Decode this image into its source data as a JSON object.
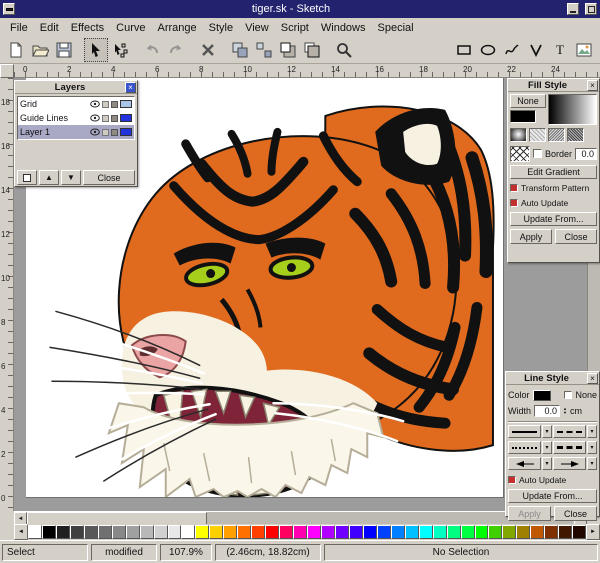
{
  "titlebar": {
    "title": "tiger.sk - Sketch"
  },
  "menubar": {
    "items": [
      "File",
      "Edit",
      "Effects",
      "Curve",
      "Arrange",
      "Style",
      "View",
      "Script",
      "Windows",
      "Special"
    ]
  },
  "toolbar": {
    "tools": [
      "new-document",
      "open-document",
      "save-document",
      "sep",
      "selection-tool",
      "edit-tool",
      "sep",
      "undo",
      "redo",
      "sep",
      "delete",
      "sep",
      "group-objects",
      "ungroup-objects",
      "move-to-front",
      "move-to-back",
      "sep",
      "zoom-tool",
      "spacer",
      "rectangle-tool",
      "ellipse-tool",
      "freehand-tool",
      "bezier-tool",
      "text-tool",
      "image-tool"
    ],
    "active": "selection-tool",
    "disabled": [
      "undo",
      "redo"
    ]
  },
  "ruler_h": {
    "ticks": [
      "0",
      "2",
      "4",
      "6",
      "8",
      "10",
      "12",
      "14",
      "16",
      "18",
      "20",
      "22",
      "24"
    ]
  },
  "ruler_v": {
    "ticks": [
      "18",
      "16",
      "14",
      "12",
      "10",
      "8",
      "6",
      "4",
      "2",
      "0"
    ]
  },
  "layers": {
    "title": "Layers",
    "rows": [
      {
        "name": "Grid",
        "color": "#aac4e8",
        "selected": false
      },
      {
        "name": "Guide Lines",
        "color": "#2233dd",
        "selected": false
      },
      {
        "name": "Layer 1",
        "color": "#2233dd",
        "selected": true
      }
    ],
    "buttons": {
      "up": "▲",
      "down": "▼",
      "close": "Close"
    }
  },
  "fill_style": {
    "title": "Fill Style",
    "none": "None",
    "border": "Border",
    "border_value": "0.0",
    "edit_gradient": "Edit Gradient",
    "transform_pattern": "Transform Pattern",
    "auto_update": "Auto Update",
    "update_from": "Update From...",
    "apply": "Apply",
    "close": "Close"
  },
  "line_style": {
    "title": "Line Style",
    "color": "Color",
    "none": "None",
    "width": "Width",
    "width_value": "0.0",
    "unit": "cm",
    "auto_update": "Auto Update",
    "update_from": "Update From...",
    "apply": "Apply",
    "close": "Close"
  },
  "statusbar": {
    "tool": "Select",
    "modified": "modified",
    "zoom": "107.9%",
    "coords": "(2.46cm, 18.82cm)",
    "selection": "No Selection"
  },
  "palette": {
    "colors": [
      "#ffffff",
      "#000000",
      "#202020",
      "#404040",
      "#585858",
      "#707070",
      "#888888",
      "#a0a0a0",
      "#b8b8b8",
      "#d0d0d0",
      "#e8e8e8",
      "#ffffff",
      "#ffff00",
      "#ffd000",
      "#ffa000",
      "#ff7000",
      "#ff4000",
      "#ff0000",
      "#ff0060",
      "#ff00b0",
      "#ff00ff",
      "#b000ff",
      "#7000ff",
      "#4000ff",
      "#0000ff",
      "#0040ff",
      "#0080ff",
      "#00c0ff",
      "#00ffff",
      "#00ffc0",
      "#00ff80",
      "#00ff40",
      "#00ff00",
      "#40d000",
      "#80a800",
      "#a08000",
      "#c05800",
      "#803000",
      "#401800",
      "#200800"
    ]
  },
  "glyphs": {
    "close": "×",
    "up": "▲",
    "down": "▼",
    "left": "◄",
    "right": "►",
    "dropdown": "▾"
  }
}
